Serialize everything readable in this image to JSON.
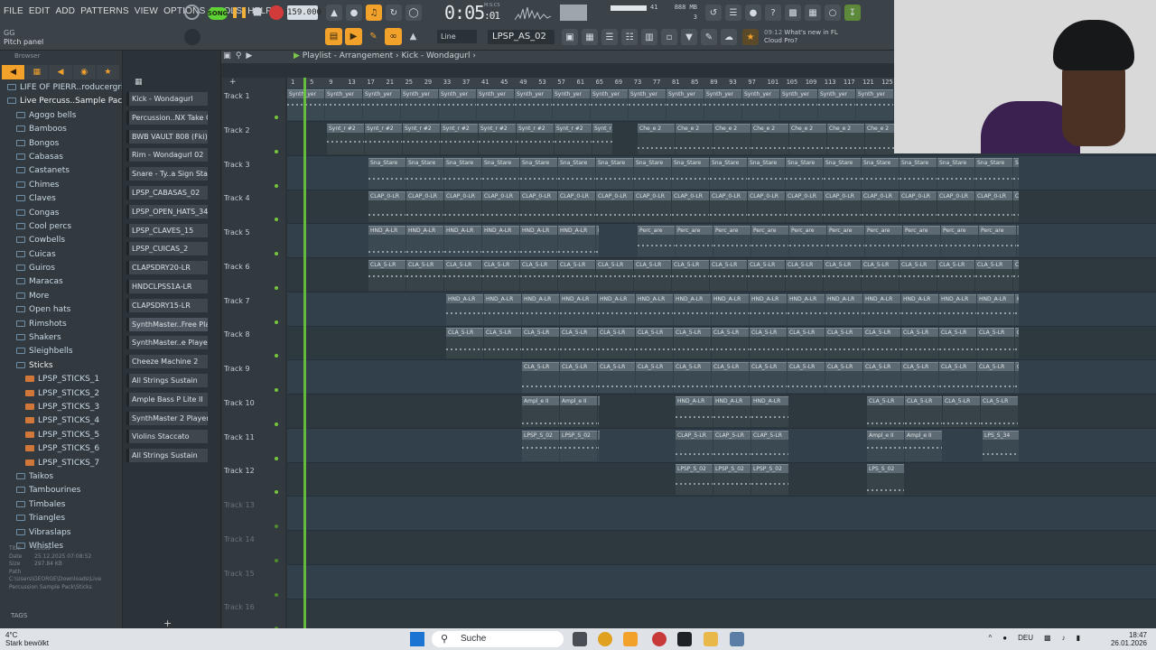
{
  "menu": [
    "FILE",
    "EDIT",
    "ADD",
    "PATTERNS",
    "VIEW",
    "OPTIONS",
    "TOOLS",
    "HELP"
  ],
  "hint": {
    "line1": "GG",
    "line2": "Pitch panel"
  },
  "transport": {
    "mode": "SONG",
    "tempo": "159.000",
    "time": "0:05",
    "time_small": "01",
    "time_label": "M:S:CS"
  },
  "cpu": {
    "ram": "888 MB",
    "poly": "3",
    "cpu_val": "41"
  },
  "snap": "Line",
  "pattern": "LPSP_AS_02",
  "news": {
    "time": "09:12",
    "line1": "What's new in FL",
    "line2": "Cloud Pro?"
  },
  "browser": {
    "title": "Browser",
    "items": [
      {
        "label": "LIFE OF PIERR..roducergrind",
        "type": "folder",
        "indent": 0
      },
      {
        "label": "Live Percuss..Sample Pack",
        "type": "folder",
        "indent": 0,
        "open": true
      },
      {
        "label": "Agogo bells",
        "type": "folder",
        "indent": 1
      },
      {
        "label": "Bamboos",
        "type": "folder",
        "indent": 1
      },
      {
        "label": "Bongos",
        "type": "folder",
        "indent": 1
      },
      {
        "label": "Cabasas",
        "type": "folder",
        "indent": 1
      },
      {
        "label": "Castanets",
        "type": "folder",
        "indent": 1
      },
      {
        "label": "Chimes",
        "type": "folder",
        "indent": 1
      },
      {
        "label": "Claves",
        "type": "folder",
        "indent": 1
      },
      {
        "label": "Congas",
        "type": "folder",
        "indent": 1
      },
      {
        "label": "Cool percs",
        "type": "folder",
        "indent": 1
      },
      {
        "label": "Cowbells",
        "type": "folder",
        "indent": 1
      },
      {
        "label": "Cuicas",
        "type": "folder",
        "indent": 1
      },
      {
        "label": "Guiros",
        "type": "folder",
        "indent": 1
      },
      {
        "label": "Maracas",
        "type": "folder",
        "indent": 1
      },
      {
        "label": "More",
        "type": "folder",
        "indent": 1
      },
      {
        "label": "Open hats",
        "type": "folder",
        "indent": 1
      },
      {
        "label": "Rimshots",
        "type": "folder",
        "indent": 1
      },
      {
        "label": "Shakers",
        "type": "folder",
        "indent": 1
      },
      {
        "label": "Sleighbells",
        "type": "folder",
        "indent": 1
      },
      {
        "label": "Sticks",
        "type": "folder",
        "indent": 1,
        "open": true
      },
      {
        "label": "LPSP_STICKS_1",
        "type": "file",
        "indent": 2
      },
      {
        "label": "LPSP_STICKS_2",
        "type": "file",
        "indent": 2
      },
      {
        "label": "LPSP_STICKS_3",
        "type": "file",
        "indent": 2
      },
      {
        "label": "LPSP_STICKS_4",
        "type": "file",
        "indent": 2
      },
      {
        "label": "LPSP_STICKS_5",
        "type": "file",
        "indent": 2
      },
      {
        "label": "LPSP_STICKS_6",
        "type": "file",
        "indent": 2
      },
      {
        "label": "LPSP_STICKS_7",
        "type": "file",
        "indent": 2
      },
      {
        "label": "Taikos",
        "type": "folder",
        "indent": 1
      },
      {
        "label": "Tambourines",
        "type": "folder",
        "indent": 1
      },
      {
        "label": "Timbales",
        "type": "folder",
        "indent": 1
      },
      {
        "label": "Triangles",
        "type": "folder",
        "indent": 1
      },
      {
        "label": "Vibraslaps",
        "type": "folder",
        "indent": 1
      },
      {
        "label": "Whistles",
        "type": "folder",
        "indent": 1
      }
    ],
    "info": [
      {
        "k": "Title",
        "v": "Sticks"
      },
      {
        "k": "Date",
        "v": "25.12.2025 07:08:52"
      },
      {
        "k": "Size",
        "v": "297.84 KB"
      },
      {
        "k": "Path",
        "v": "C:\\Users\\GEORGE\\Downloads\\Live Percussion Sample Pack\\Sticks"
      }
    ],
    "tags": "TAGS"
  },
  "rack": [
    "Kick - Wondagurl",
    "Percussion..NX Take Care",
    "BWB VAULT 808 (Fki)",
    "Rim - Wondagurl 02",
    "Snare - Ty..a Sign Stare",
    "LPSP_CABASAS_02",
    "LPSP_OPEN_HATS_34",
    "LPSP_CLAVES_15",
    "LPSP_CUICAS_2",
    "CLAPSDRY20-LR",
    "HNDCLPSS1A-LR",
    "CLAPSDRY15-LR",
    "SynthMaster..Free Player",
    "SynthMaster..e Player #2",
    "Cheeze Machine 2",
    "All Strings Sustain",
    "Ample Bass P Lite II",
    "SynthMaster 2 Player",
    "Violins Staccato",
    "All Strings Sustain"
  ],
  "playlist": {
    "title": "Playlist - Arrangement",
    "pattern": "Kick - Wondagurl",
    "ruler": [
      "1",
      "5",
      "9",
      "13",
      "17",
      "21",
      "25",
      "29",
      "33",
      "37",
      "41",
      "45",
      "49",
      "53",
      "57",
      "61",
      "65",
      "69",
      "73",
      "77",
      "81",
      "85",
      "89",
      "93",
      "97",
      "101",
      "105",
      "109",
      "113",
      "117",
      "121",
      "125"
    ],
    "tracks": [
      {
        "name": "Track 1",
        "active": true,
        "clips": [
          {
            "s": 0,
            "e": 672,
            "l": "Synth_yer"
          }
        ]
      },
      {
        "name": "Track 2",
        "active": true,
        "clips": [
          {
            "s": 44,
            "e": 360,
            "l": "Synt_r #2"
          },
          {
            "s": 388,
            "e": 672,
            "l": "Che_e 2"
          }
        ]
      },
      {
        "name": "Track 3",
        "active": true,
        "clips": [
          {
            "s": 90,
            "e": 810,
            "l": "Sna_Stare"
          }
        ]
      },
      {
        "name": "Track 4",
        "active": true,
        "clips": [
          {
            "s": 90,
            "e": 810,
            "l": "CLAP_0-LR"
          }
        ]
      },
      {
        "name": "Track 5",
        "active": true,
        "clips": [
          {
            "s": 90,
            "e": 345,
            "l": "HND_A-LR"
          },
          {
            "s": 388,
            "e": 810,
            "l": "Perc_are"
          }
        ]
      },
      {
        "name": "Track 6",
        "active": true,
        "clips": [
          {
            "s": 90,
            "e": 810,
            "l": "CLA_5-LR"
          }
        ]
      },
      {
        "name": "Track 7",
        "active": true,
        "clips": [
          {
            "s": 176,
            "e": 810,
            "l": "HND_A-LR"
          }
        ]
      },
      {
        "name": "Track 8",
        "active": true,
        "clips": [
          {
            "s": 176,
            "e": 810,
            "l": "CLA_5-LR"
          }
        ]
      },
      {
        "name": "Track 9",
        "active": true,
        "clips": [
          {
            "s": 260,
            "e": 810,
            "l": "CLA_5-LR"
          }
        ]
      },
      {
        "name": "Track 10",
        "active": true,
        "clips": [
          {
            "s": 260,
            "e": 345,
            "l": "Ampl_e II"
          },
          {
            "s": 430,
            "e": 556,
            "l": "HND_A-LR"
          },
          {
            "s": 642,
            "e": 810,
            "l": "CLA_5-LR"
          }
        ]
      },
      {
        "name": "Track 11",
        "active": true,
        "clips": [
          {
            "s": 260,
            "e": 345,
            "l": "LPSP_S_02"
          },
          {
            "s": 430,
            "e": 556,
            "l": "CLAP_5-LR"
          },
          {
            "s": 642,
            "e": 726,
            "l": "Ampl_e II"
          },
          {
            "s": 770,
            "e": 810,
            "l": "LPS_S_34"
          }
        ]
      },
      {
        "name": "Track 12",
        "active": true,
        "clips": [
          {
            "s": 430,
            "e": 556,
            "l": "LPSP_S_02"
          },
          {
            "s": 642,
            "e": 684,
            "l": "LPS_S_02"
          }
        ]
      },
      {
        "name": "Track 13",
        "active": false,
        "clips": []
      },
      {
        "name": "Track 14",
        "active": false,
        "clips": []
      },
      {
        "name": "Track 15",
        "active": false,
        "clips": []
      },
      {
        "name": "Track 16",
        "active": false,
        "clips": []
      }
    ]
  },
  "taskbar": {
    "temp": "4°C",
    "weather": "Stark bewölkt",
    "search": "Suche",
    "lang": "DEU",
    "time": "18:47",
    "date": "26.01.2026"
  }
}
